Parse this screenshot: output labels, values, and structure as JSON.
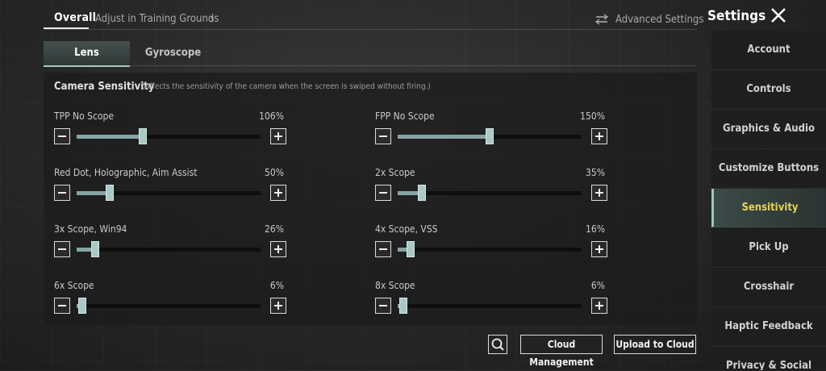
{
  "topbar": {
    "overall_tab": "Overall",
    "adjust_tab": "Adjust in Training Grounds",
    "advanced_settings": "Advanced Settings",
    "settings_title": "Settings"
  },
  "subtabs": [
    "Lens",
    "Gyroscope"
  ],
  "camera_sensitivity": {
    "title": "Camera Sensitivity",
    "note": "(Affects the sensitivity of the camera when the screen is swiped without firing.)",
    "sliders": [
      {
        "label": "TPP No Scope",
        "value_text": "106%",
        "fill": 0.36
      },
      {
        "label": "FPP No Scope",
        "value_text": "150%",
        "fill": 0.5
      },
      {
        "label": "Red Dot, Holographic, Aim Assist",
        "value_text": "50%",
        "fill": 0.18
      },
      {
        "label": "2x Scope",
        "value_text": "35%",
        "fill": 0.13
      },
      {
        "label": "3x Scope, Win94",
        "value_text": "26%",
        "fill": 0.1
      },
      {
        "label": "4x Scope, VSS",
        "value_text": "16%",
        "fill": 0.07
      },
      {
        "label": "6x Scope",
        "value_text": "6%",
        "fill": 0.03
      },
      {
        "label": "8x Scope",
        "value_text": "6%",
        "fill": 0.03
      }
    ]
  },
  "bottom_buttons": {
    "cloud_management": "Cloud Management",
    "upload_to_cloud": "Upload to Cloud"
  },
  "sidebar": {
    "items": [
      {
        "label": "Account",
        "active": false
      },
      {
        "label": "Controls",
        "active": false
      },
      {
        "label": "Graphics & Audio",
        "active": false
      },
      {
        "label": "Customize Buttons",
        "active": false
      },
      {
        "label": "Sensitivity",
        "active": true
      },
      {
        "label": "Pick Up",
        "active": false
      },
      {
        "label": "Crosshair",
        "active": false
      },
      {
        "label": "Haptic Feedback",
        "active": false
      },
      {
        "label": "Privacy & Social",
        "active": false
      }
    ]
  },
  "colors": {
    "accent": "#a9c8c6",
    "active_text": "#e8d15a"
  },
  "icons": [
    "chevron-right-icon",
    "sliders-icon",
    "close-icon",
    "search-icon",
    "minus-icon",
    "plus-icon"
  ]
}
